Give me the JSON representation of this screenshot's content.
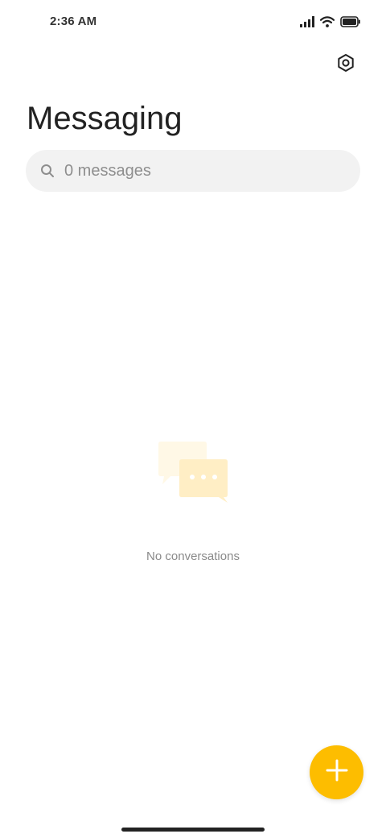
{
  "status_bar": {
    "time": "2:36 AM",
    "icons": [
      "signal-icon",
      "wifi-icon",
      "battery-icon"
    ]
  },
  "header": {
    "settings_icon": "gear-icon",
    "title": "Messaging"
  },
  "search": {
    "icon": "search-icon",
    "placeholder": "0 messages",
    "value": ""
  },
  "empty_state": {
    "illustration": "chat-bubbles-icon",
    "text": "No conversations"
  },
  "fab": {
    "icon": "plus-icon"
  },
  "colors": {
    "accent": "#fdbd00",
    "search_bg": "#f2f2f2",
    "illustration_back": "#fff8e6",
    "illustration_front": "#ffeec5"
  }
}
